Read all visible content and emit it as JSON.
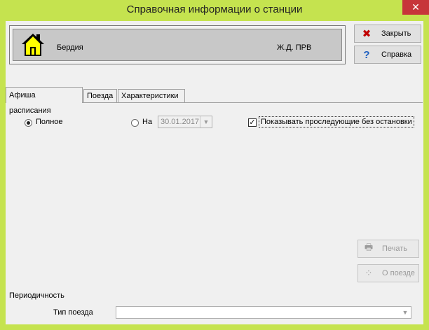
{
  "window": {
    "title": "Справочная информации о станции",
    "close_glyph": "✕"
  },
  "station": {
    "name": "Бердия",
    "code": "Ж.Д. ПРВ",
    "icon": "house-icon"
  },
  "buttons": {
    "close_label": "Закрыть",
    "help_label": "Справка",
    "print_label": "Печать",
    "train_info_label": "О поезде"
  },
  "tabs": [
    {
      "label": "Афиша расписания",
      "active": true
    },
    {
      "label": "Поезда",
      "active": false
    },
    {
      "label": "Характеристики",
      "active": false
    }
  ],
  "schedule": {
    "radio_full_label": "Полное",
    "radio_full_selected": true,
    "radio_on_label": "На",
    "radio_on_selected": false,
    "date_value": "30.01.2017",
    "checkbox_label": "Показывать проследующие без остановки",
    "checkbox_checked": true,
    "periodicity_label": "Периодичность",
    "train_type_label": "Тип поезда",
    "train_type_value": ""
  },
  "colors": {
    "titlebar": "#c5e34f",
    "close_button": "#c7353a"
  }
}
